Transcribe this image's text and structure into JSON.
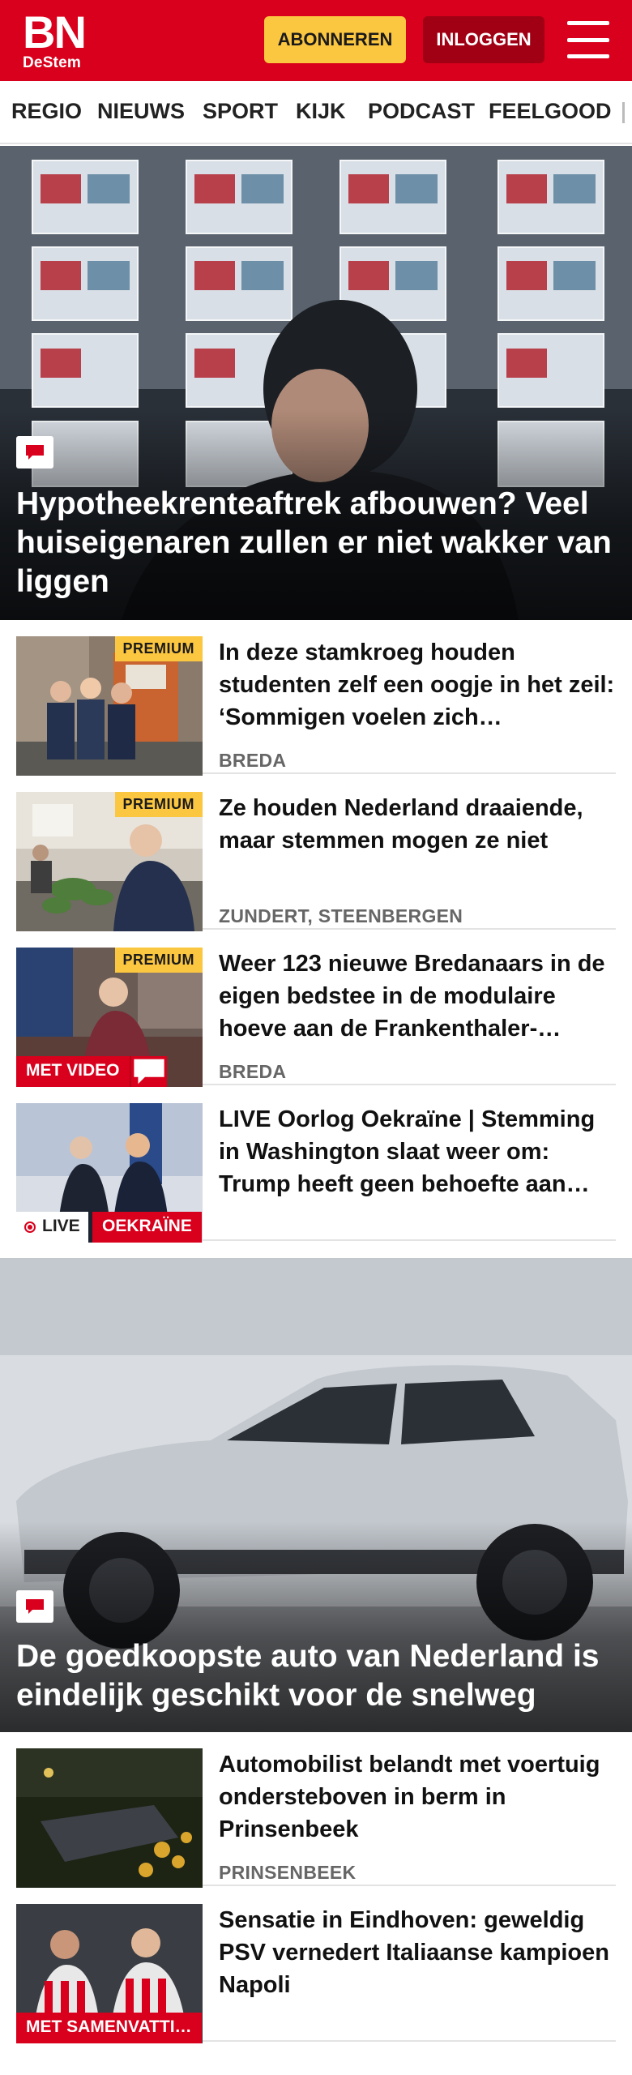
{
  "header": {
    "logo_main": "BN",
    "logo_sub": "DeStem",
    "subscribe_label": "ABONNEREN",
    "login_label": "INLOGGEN",
    "menu_icon": "hamburger-menu-icon",
    "brand_color": "#d8001c",
    "accent_color": "#fbc640"
  },
  "nav": {
    "items": [
      "REGIO",
      "NIEUWS",
      "SPORT",
      "KIJK",
      "PODCAST",
      "FEELGOOD"
    ]
  },
  "hero1": {
    "title": "Hypotheekrenteaftrek afbouwen? Veel huiseigenaren zullen er niet wakker van liggen",
    "icon": "comment-icon"
  },
  "articles1": [
    {
      "title": "In deze stamkroeg houden studenten zelf een oogje in het zeil: ‘Sommigen voelen zich…",
      "location": "BREDA",
      "premium": "PREMIUM"
    },
    {
      "title": "Ze houden Nederland draaiende, maar stemmen mogen ze niet",
      "location": "ZUNDERT, STEENBERGEN",
      "premium": "PREMIUM"
    },
    {
      "title": "Weer 123 nieuwe Bredanaars in de eigen bedstee in de modulaire hoeve aan de Frankenthaler-…",
      "location": "BREDA",
      "premium": "PREMIUM",
      "video_label": "MET VIDEO"
    },
    {
      "title": "LIVE Oorlog Oekraïne | Stemming in Washington slaat weer om: Trump heeft geen behoefte aan…",
      "live_label": "LIVE",
      "tag": "OEKRAÏNE"
    }
  ],
  "hero2": {
    "title": "De goedkoopste auto van Nederland is eindelijk geschikt voor de snelweg",
    "icon": "comment-icon"
  },
  "articles2": [
    {
      "title": "Automobilist belandt met voertuig ondersteboven in berm in Prinsenbeek",
      "location": "PRINSENBEEK"
    },
    {
      "title": "Sensatie in Eindhoven: geweldig PSV vernedert Italiaanse kampioen Napoli",
      "summary_label": "MET SAMENVATTI…"
    }
  ]
}
